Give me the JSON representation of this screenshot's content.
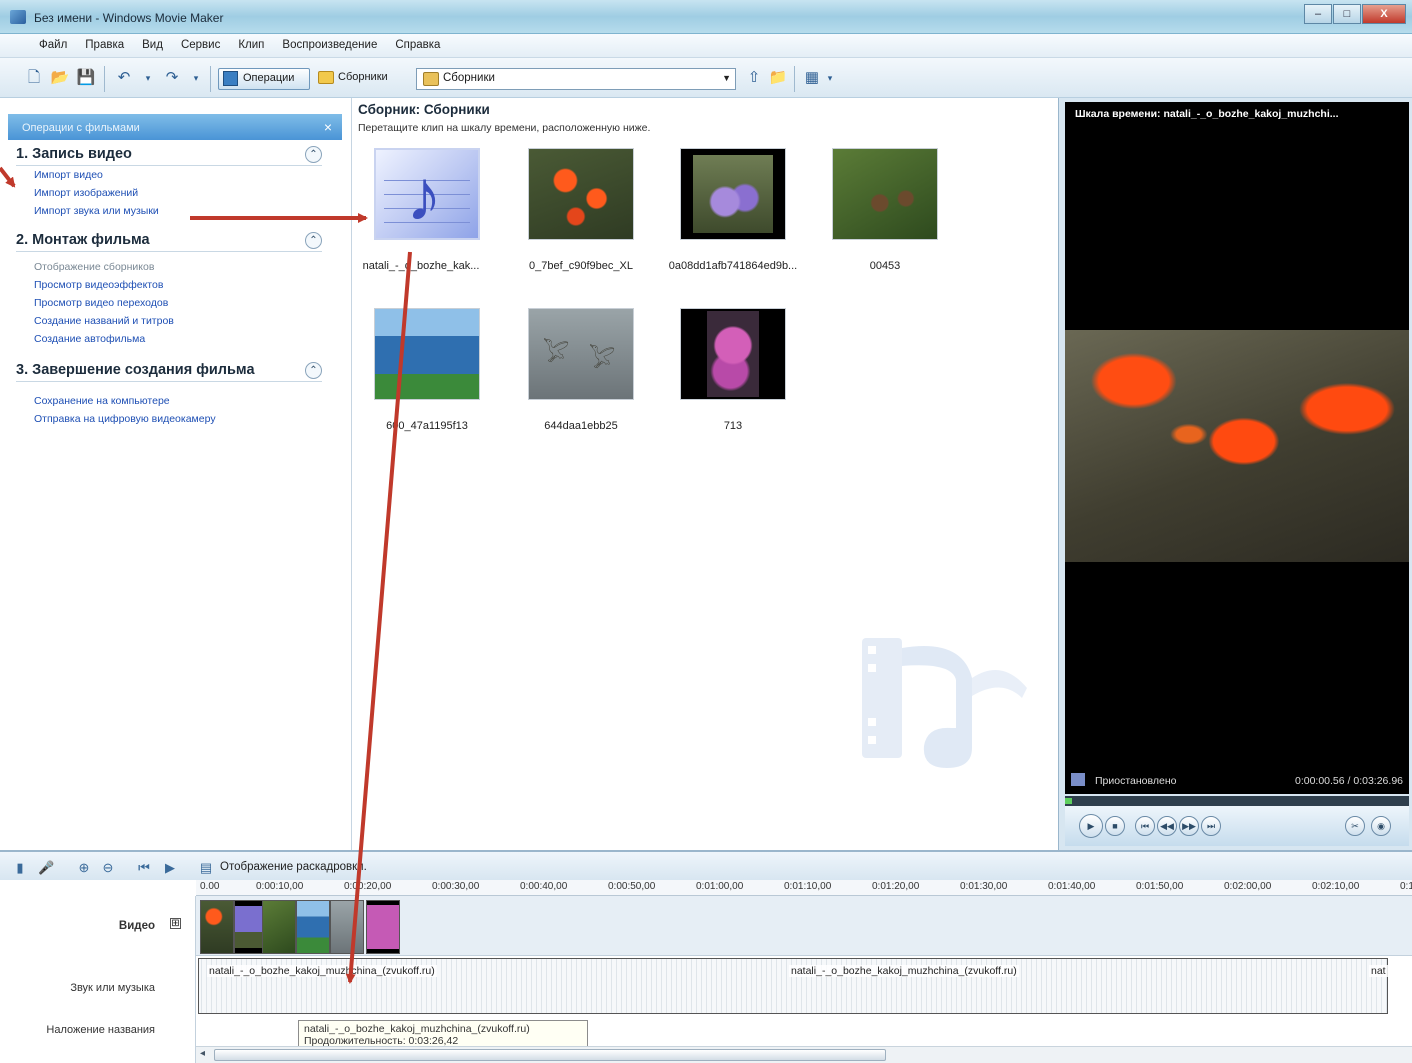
{
  "window": {
    "title": "Без имени - Windows Movie Maker",
    "minimize": "–",
    "maximize": "□",
    "close": "X"
  },
  "menu": [
    "Файл",
    "Правка",
    "Вид",
    "Сервис",
    "Клип",
    "Воспроизведение",
    "Справка"
  ],
  "toolbar": {
    "operations_label": "Операции",
    "collections_label": "Сборники",
    "collection_select": "Сборники"
  },
  "tasks": {
    "header": "Операции с фильмами",
    "close": "×",
    "sections": [
      {
        "title": "1. Запись видео",
        "links": [
          {
            "text": "Импорт видео",
            "disabled": false
          },
          {
            "text": "Импорт изображений",
            "disabled": false
          },
          {
            "text": "Импорт звука или музыки",
            "disabled": false
          }
        ]
      },
      {
        "title": "2. Монтаж фильма",
        "links": [
          {
            "text": "Отображение сборников",
            "disabled": true
          },
          {
            "text": "Просмотр видеоэффектов",
            "disabled": false
          },
          {
            "text": "Просмотр видео переходов",
            "disabled": false
          },
          {
            "text": "Создание названий и титров",
            "disabled": false
          },
          {
            "text": "Создание автофильма",
            "disabled": false
          }
        ]
      },
      {
        "title": "3. Завершение создания фильма",
        "links": [
          {
            "text": "Сохранение на компьютере",
            "disabled": false
          },
          {
            "text": "Отправка на цифровую видеокамеру",
            "disabled": false
          }
        ]
      }
    ]
  },
  "collection": {
    "title": "Сборник: Сборники",
    "hint": "Перетащите клип на шкалу времени, расположенную ниже.",
    "clips": [
      {
        "label": "natali_-_o_bozhe_kak...",
        "kind": "music"
      },
      {
        "label": "0_7bef_c90f9bec_XL",
        "kind": "lily"
      },
      {
        "label": "0a08dd1afb741864ed9b...",
        "kind": "purple"
      },
      {
        "label": "00453",
        "kind": "pine"
      },
      {
        "label": "600_47a1195f13",
        "kind": "house"
      },
      {
        "label": "644daa1ebb25",
        "kind": "birds"
      },
      {
        "label": "713",
        "kind": "pink"
      }
    ]
  },
  "preview": {
    "title": "Шкала времени: natali_-_o_bozhe_kakoj_muzhchi...",
    "state": "Приостановлено",
    "time": "0:00:00.56 / 0:03:26.96",
    "progress": 0.003
  },
  "timeline": {
    "mode_label": "Отображение раскадровки.",
    "ruler": [
      "0.00",
      "0:00:10,00",
      "0:00:20,00",
      "0:00:30,00",
      "0:00:40,00",
      "0:00:50,00",
      "0:01:00,00",
      "0:01:10,00",
      "0:01:20,00",
      "0:01:30,00",
      "0:01:40,00",
      "0:01:50,00",
      "0:02:00,00",
      "0:02:10,00",
      "0:1"
    ],
    "tracks": {
      "video": "Видео",
      "expand": "⊞",
      "audio": "Звук или музыка",
      "title_overlay": "Наложение названия"
    },
    "audio_segments": [
      "natali_-_o_bozhe_kakoj_muzhchina_(zvukoff.ru)",
      "natali_-_o_bozhe_kakoj_muzhchina_(zvukoff.ru)",
      "nat"
    ],
    "tooltip": {
      "name": "natali_-_o_bozhe_kakoj_muzhchina_(zvukoff.ru)",
      "duration": "Продолжительность: 0:03:26,42"
    }
  },
  "colors": {
    "link": "#1e4fb4",
    "arrow": "#c0392b",
    "task_header": "#4a94d6"
  }
}
